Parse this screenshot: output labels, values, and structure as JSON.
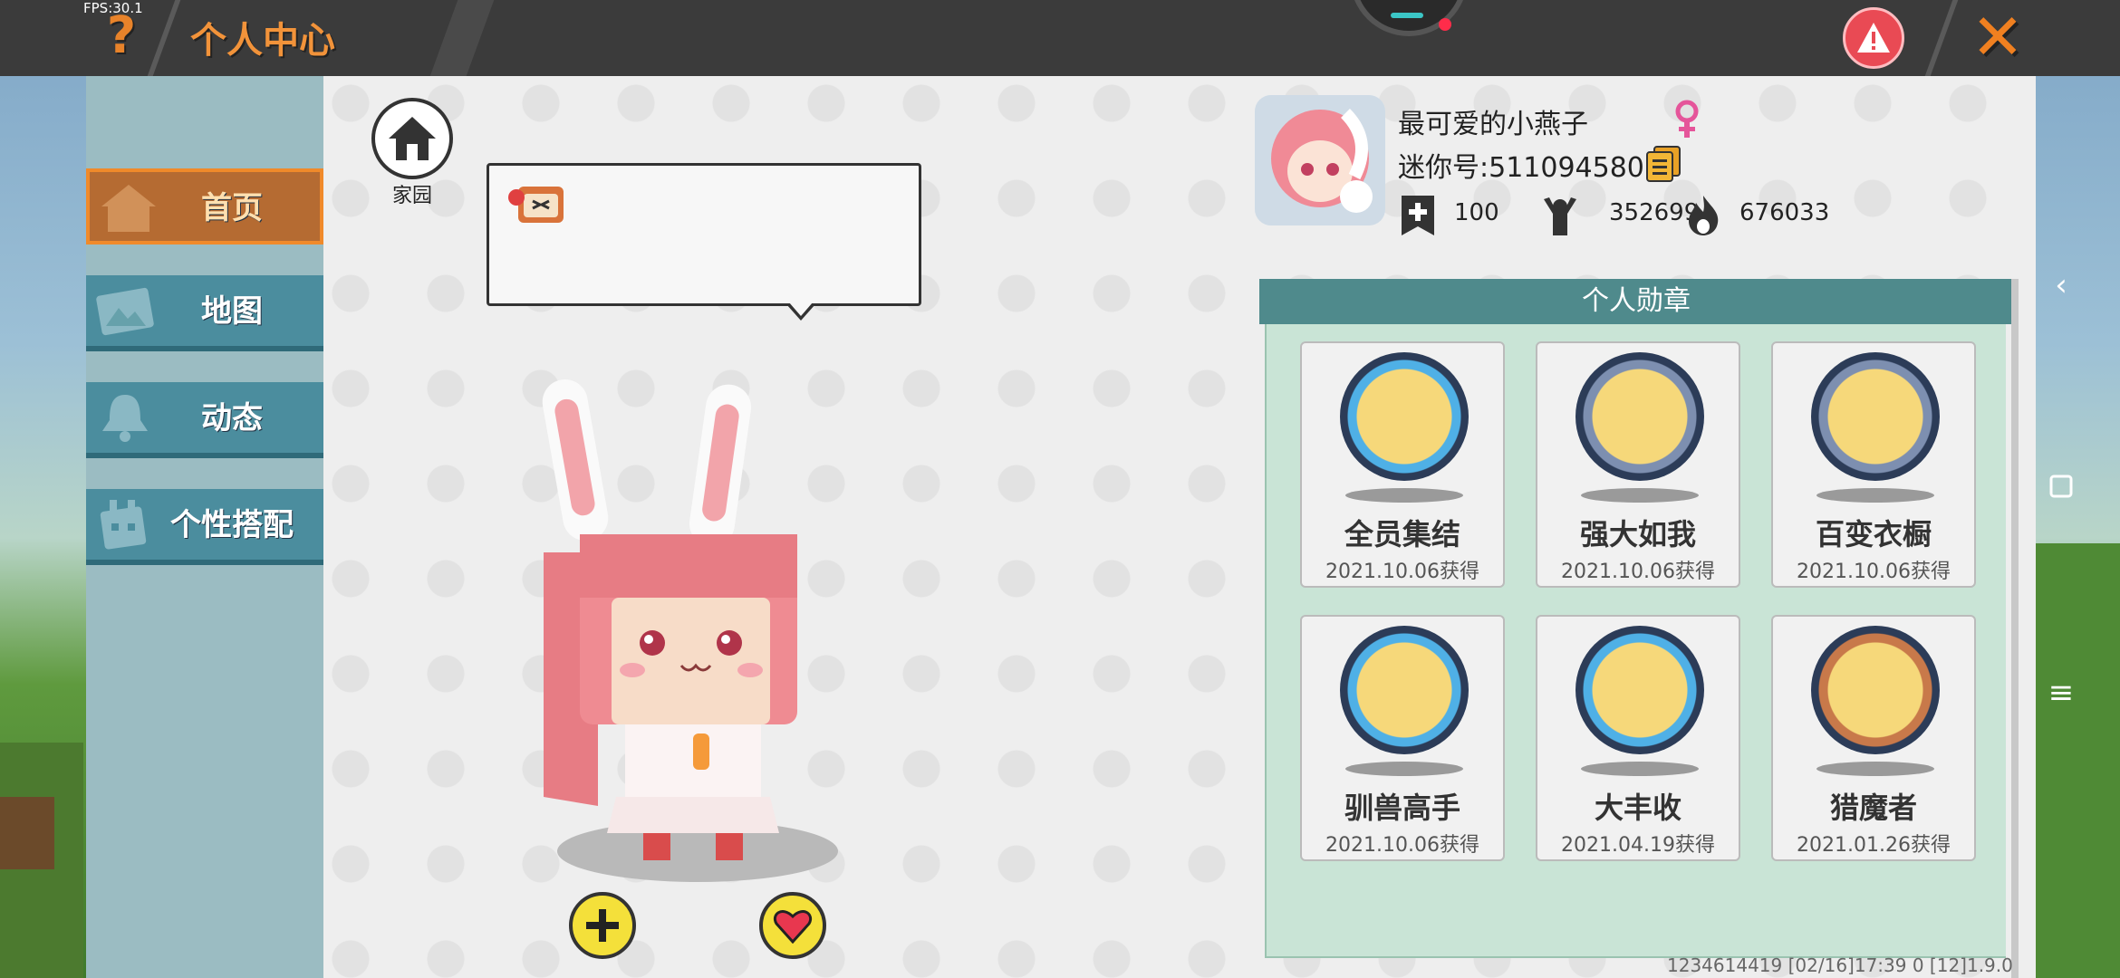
{
  "hud": {
    "fps": "FPS:30.1",
    "title": "个人中心"
  },
  "nav": {
    "items": [
      {
        "label": "首页",
        "icon": "home-icon",
        "active": true
      },
      {
        "label": "地图",
        "icon": "map-icon",
        "active": false
      },
      {
        "label": "动态",
        "icon": "bell-icon",
        "active": false
      },
      {
        "label": "个性搭配",
        "icon": "outfit-icon",
        "active": false
      }
    ]
  },
  "home": {
    "label": "家园"
  },
  "profile": {
    "nickname": "最可爱的小燕子",
    "mini_id": "迷你号:511094580",
    "stats": {
      "level": "100",
      "fans": "352699",
      "popularity": "676033"
    }
  },
  "medals": {
    "header": "个人勋章",
    "items": [
      {
        "name": "全员集结",
        "date": "2021.10.06获得",
        "color": "#4fb0e6",
        "icon": "bear-medal-icon"
      },
      {
        "name": "强大如我",
        "date": "2021.10.06获得",
        "color": "#7d8fb0",
        "icon": "rocket-medal-icon"
      },
      {
        "name": "百变衣橱",
        "date": "2021.10.06获得",
        "color": "#7d8fb0",
        "icon": "wardrobe-medal-icon"
      },
      {
        "name": "驯兽高手",
        "date": "2021.10.06获得",
        "color": "#4fb0e6",
        "icon": "beast-medal-icon"
      },
      {
        "name": "大丰收",
        "date": "2021.04.19获得",
        "color": "#4fb0e6",
        "icon": "harvest-medal-icon"
      },
      {
        "name": "猎魔者",
        "date": "2021.01.26获得",
        "color": "#c8794a",
        "icon": "swords-medal-icon"
      }
    ]
  },
  "footer": {
    "info": "1234614419   [02/16]17:39 0   [12]1.9.0"
  },
  "colors": {
    "accent_orange": "#f2933a",
    "nav_teal": "#4b8d9e",
    "medal_header": "#4f8a8c"
  }
}
